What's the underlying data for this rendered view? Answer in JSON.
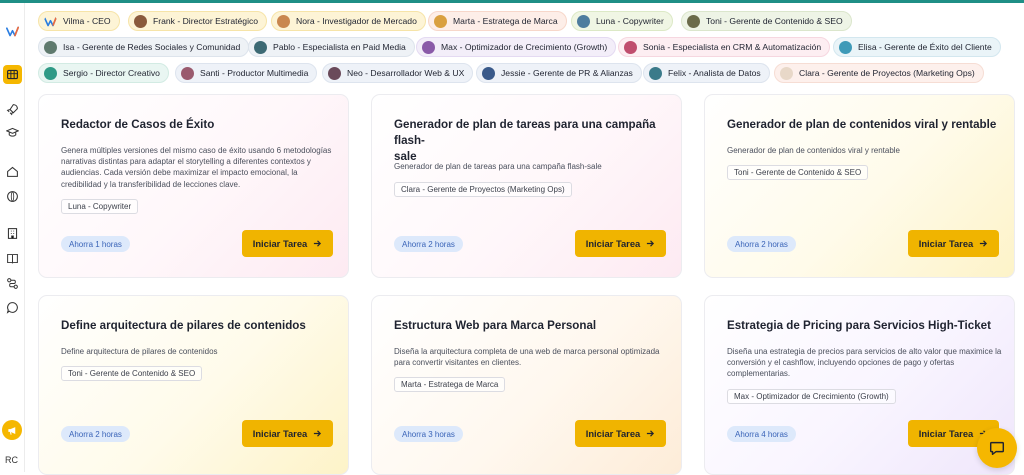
{
  "colors": {
    "accent": "#f0b400",
    "top_line": "#1f8f86",
    "time_badge_bg": "#dde9fb",
    "time_badge_text": "#3a64b8"
  },
  "sidebar": {
    "user_initials": "RC"
  },
  "agents": [
    {
      "label": "Vilma - CEO",
      "avatar_color": "#ffffff",
      "icon": "vilma-logo-icon"
    },
    {
      "label": "Frank - Director Estratégico",
      "avatar_color": "#8a5a3c"
    },
    {
      "label": "Nora - Investigador de Mercado",
      "avatar_color": "#c9874f"
    },
    {
      "label": "Marta - Estratega de Marca",
      "avatar_color": "#d9a040"
    },
    {
      "label": "Luna - Copywriter",
      "avatar_color": "#4e7d9e"
    },
    {
      "label": "Toni - Gerente de Contenido & SEO",
      "avatar_color": "#6b6b4a"
    },
    {
      "label": "Isa - Gerente de Redes Sociales y Comunidad",
      "avatar_color": "#5f7a6e"
    },
    {
      "label": "Pablo - Especialista en Paid Media",
      "avatar_color": "#3d6a74"
    },
    {
      "label": "Max - Optimizador de Crecimiento (Growth)",
      "avatar_color": "#8a5aa8"
    },
    {
      "label": "Sonia - Especialista en CRM & Automatización",
      "avatar_color": "#c04e6e"
    },
    {
      "label": "Elisa - Gerente de Éxito del Cliente",
      "avatar_color": "#3f9ab8"
    },
    {
      "label": "Sergio - Director Creativo",
      "avatar_color": "#2f9a86"
    },
    {
      "label": "Santi - Productor Multimedia",
      "avatar_color": "#9a5a6e"
    },
    {
      "label": "Neo - Desarrollador Web & UX",
      "avatar_color": "#6a4a5a"
    },
    {
      "label": "Jessie - Gerente de PR & Alianzas",
      "avatar_color": "#3a5a8a"
    },
    {
      "label": "Felix - Analista de Datos",
      "avatar_color": "#3a7a8a"
    },
    {
      "label": "Clara - Gerente de Proyectos (Marketing Ops)",
      "avatar_color": "#e8d8c8"
    }
  ],
  "tasks": [
    {
      "title_lines": [
        "Redactor de Casos de Éxito"
      ],
      "description_lines": [
        "Genera múltiples versiones del mismo caso de éxito usando 6 metodologías",
        "narrativas distintas para adaptar el storytelling a diferentes contextos y",
        "audiencias. Cada versión debe maximizar el impacto emocional, la",
        "credibilidad y la transferibilidad de lecciones clave."
      ],
      "tag": "Luna - Copywriter",
      "time": "Ahorra 1 horas",
      "button": "Iniciar Tarea"
    },
    {
      "title_lines": [
        "Generador de plan de tareas para una campaña flash-",
        "sale"
      ],
      "description_lines": [
        "Generador de plan de tareas para una campaña flash-sale"
      ],
      "tag": "Clara - Gerente de Proyectos (Marketing Ops)",
      "time": "Ahorra 2 horas",
      "button": "Iniciar Tarea"
    },
    {
      "title_lines": [
        "Generador de plan de contenidos viral y rentable"
      ],
      "description_lines": [
        "Generador de plan de contenidos viral y rentable"
      ],
      "tag": "Toni - Gerente de Contenido & SEO",
      "time": "Ahorra 2 horas",
      "button": "Iniciar Tarea"
    },
    {
      "title_lines": [
        "Define arquitectura de pilares de contenidos"
      ],
      "description_lines": [
        "Define arquitectura de pilares de contenidos"
      ],
      "tag": "Toni - Gerente de Contenido & SEO",
      "time": "Ahorra 2 horas",
      "button": "Iniciar Tarea"
    },
    {
      "title_lines": [
        "Estructura Web para Marca Personal"
      ],
      "description_lines": [
        "Diseña la arquitectura completa de una web de marca personal optimizada",
        "para convertir visitantes en clientes."
      ],
      "tag": "Marta - Estratega de Marca",
      "time": "Ahorra 3 horas",
      "button": "Iniciar Tarea"
    },
    {
      "title_lines": [
        "Estrategia de Pricing para Servicios High-Ticket"
      ],
      "description_lines": [
        "Diseña una estrategia de precios para servicios de alto valor que maximice la",
        "conversión y el cashflow, incluyendo opciones de pago y ofertas",
        "complementarias."
      ],
      "tag": "Max - Optimizador de Crecimiento (Growth)",
      "time": "Ahorra 4 horas",
      "button": "Iniciar Tarea"
    }
  ]
}
